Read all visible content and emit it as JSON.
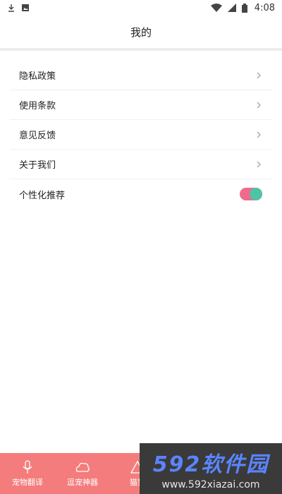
{
  "status_bar": {
    "time": "4:08",
    "icons": [
      "download-icon",
      "image-icon",
      "wifi-icon",
      "signal-icon",
      "battery-icon"
    ]
  },
  "header": {
    "title": "我的"
  },
  "menu": {
    "items": [
      {
        "label": "隐私政策",
        "icon": "chevron-right-icon"
      },
      {
        "label": "使用条款",
        "icon": "chevron-right-icon"
      },
      {
        "label": "意见反馈",
        "icon": "chevron-right-icon"
      },
      {
        "label": "关于我们",
        "icon": "chevron-right-icon"
      }
    ],
    "toggle_item": {
      "label": "个性化推荐",
      "enabled": true
    }
  },
  "tab_bar": {
    "tabs": [
      {
        "label": "宠物翻译",
        "icon": "microphone-icon"
      },
      {
        "label": "逗宠神器",
        "icon": "cloud-icon"
      },
      {
        "label": "猫狗",
        "icon": "triangle-icon"
      }
    ]
  },
  "watermark": {
    "title": "592软件园",
    "url": "www.592xiazai.com"
  },
  "colors": {
    "tab_bar": "#f47c7c",
    "toggle_track": "#f06a8e",
    "toggle_knob": "#4fc3a6",
    "watermark_title": "#5b84ff"
  }
}
